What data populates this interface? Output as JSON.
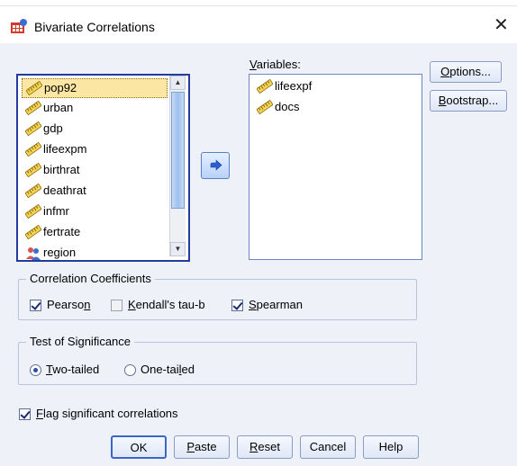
{
  "window": {
    "title": "Bivariate Correlations",
    "close_glyph": "✕"
  },
  "source_list": {
    "items": [
      {
        "label": "pop92",
        "icon": "scale-ruler-icon",
        "selected": true
      },
      {
        "label": "urban",
        "icon": "scale-ruler-icon"
      },
      {
        "label": "gdp",
        "icon": "scale-ruler-icon"
      },
      {
        "label": "lifeexpm",
        "icon": "scale-ruler-icon"
      },
      {
        "label": "birthrat",
        "icon": "scale-ruler-icon"
      },
      {
        "label": "deathrat",
        "icon": "scale-ruler-icon"
      },
      {
        "label": "infmr",
        "icon": "scale-ruler-icon"
      },
      {
        "label": "fertrate",
        "icon": "scale-ruler-icon"
      },
      {
        "label": "region",
        "icon": "nominal-people-icon"
      }
    ]
  },
  "variables": {
    "label_pre": "",
    "label_u": "V",
    "label_post": "ariables:",
    "items": [
      {
        "label": "lifeexpf",
        "icon": "scale-ruler-icon"
      },
      {
        "label": "docs",
        "icon": "scale-ruler-icon"
      }
    ]
  },
  "side_buttons": {
    "options": {
      "u": "O",
      "rest": "ptions..."
    },
    "bootstrap": {
      "u": "B",
      "rest": "ootstrap..."
    }
  },
  "correlation_coefficients": {
    "title": "Correlation Coefficients",
    "pearson": {
      "pre": "Pearso",
      "u": "n",
      "post": "",
      "checked": true
    },
    "kendall": {
      "pre": "",
      "u": "K",
      "post": "endall's tau-b",
      "checked": false
    },
    "spearman": {
      "pre": "",
      "u": "S",
      "post": "pearman",
      "checked": true
    }
  },
  "test_of_significance": {
    "title": "Test of Significance",
    "two_tailed": {
      "pre": "",
      "u": "T",
      "post": "wo-tailed",
      "selected": true
    },
    "one_tailed": {
      "pre": "One-tai",
      "u": "l",
      "post": "ed",
      "selected": false
    }
  },
  "flag": {
    "pre": "",
    "u": "F",
    "post": "lag significant correlations",
    "checked": true
  },
  "footer_buttons": {
    "ok": "OK",
    "paste": {
      "u": "P",
      "rest": "aste"
    },
    "reset": {
      "u": "R",
      "rest": "eset"
    },
    "cancel": "Cancel",
    "help": "Help"
  },
  "colors": {
    "accent": "#2c4fa8",
    "panel_bg": "#eef2f8",
    "selection": "#fbe6a4"
  }
}
